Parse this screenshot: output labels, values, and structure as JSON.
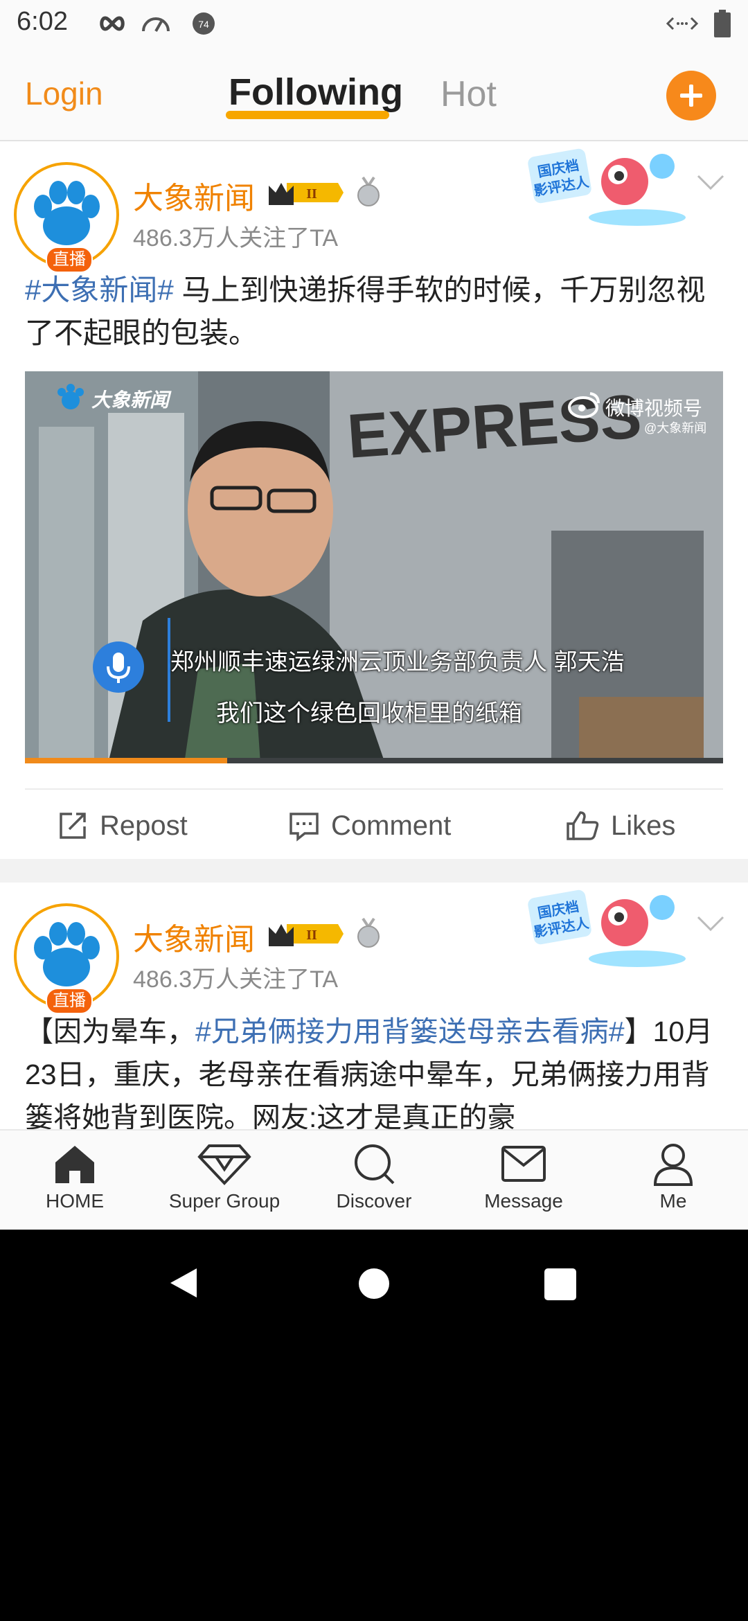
{
  "status_bar": {
    "time": "6:02"
  },
  "top_nav": {
    "login": "Login",
    "tabs": [
      "Following",
      "Hot"
    ],
    "active_tab": "Following"
  },
  "posts": [
    {
      "author": "大象新闻",
      "live_badge": "直播",
      "followers": "486.3万人关注了TA",
      "hashtag": "#大象新闻#",
      "text": " 马上到快递拆得手软的时候，千万别忽视了不起眼的包装。",
      "video": {
        "watermark_left": "大象新闻",
        "watermark_right": "微博视频号",
        "watermark_right_sub": "@大象新闻",
        "subtitle_line1": "郑州顺丰速运绿洲云顶业务部负责人 郭天浩",
        "subtitle_line2": "我们这个绿色回收柜里的纸箱",
        "progress": 0.29
      },
      "actions": {
        "repost": "Repost",
        "comment": "Comment",
        "likes": "Likes"
      }
    },
    {
      "author": "大象新闻",
      "live_badge": "直播",
      "followers": "486.3万人关注了TA",
      "text_prefix": "【因为晕车，",
      "hashtag": "#兄弟俩接力用背篓送母亲去看病#",
      "text_suffix": "】10月23日，重庆，老母亲在看病途中晕车，兄弟俩接力用背篓将她背到医院。网友:这才是真正的豪"
    }
  ],
  "campaign_badge": {
    "line1": "国庆档",
    "line2": "影评达人"
  },
  "bottom_nav": [
    "HOME",
    "Super Group",
    "Discover",
    "Message",
    "Me"
  ]
}
